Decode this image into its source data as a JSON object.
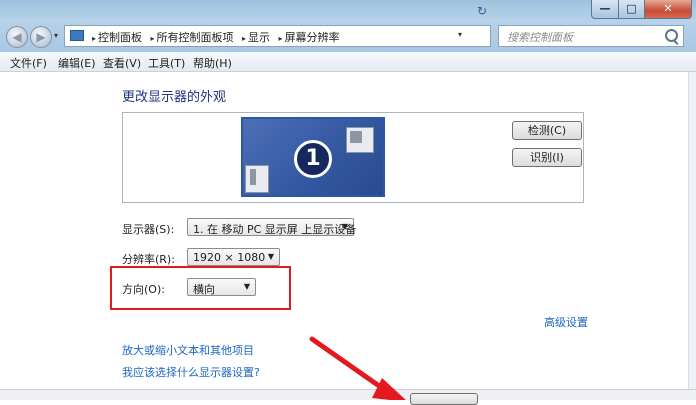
{
  "window": {
    "minimize_glyph": "—",
    "maximize_glyph": "□",
    "close_glyph": "✕"
  },
  "nav": {
    "back_glyph": "◀",
    "forward_glyph": "▶",
    "history_glyph": "▾"
  },
  "address": {
    "crumbs": [
      "控制面板",
      "所有控制面板项",
      "显示",
      "屏幕分辨率"
    ],
    "separator_glyph": "▸",
    "dropdown_glyph": "▾",
    "refresh_glyph": "↻"
  },
  "search": {
    "placeholder": "搜索控制面板"
  },
  "menu": [
    "文件(F)",
    "编辑(E)",
    "查看(V)",
    "工具(T)",
    "帮助(H)"
  ],
  "main": {
    "heading": "更改显示器的外观",
    "monitor_number": "1",
    "detect_button": "检测(C)",
    "identify_button": "识别(I)",
    "display_label": "显示器(S):",
    "display_value": "1. 在 移动 PC 显示屏 上显示设备",
    "resolution_label": "分辨率(R):",
    "resolution_value": "1920 × 1080",
    "orientation_label": "方向(O):",
    "orientation_value": "横向",
    "select_arrow": "▼",
    "advanced_link": "高级设置",
    "magnify_link": "放大或缩小文本和其他项目",
    "which_link": "我应该选择什么显示器设置?"
  },
  "colors": {
    "annotation": "#e3191f",
    "link": "#1c67c2",
    "heading": "#1e3287"
  }
}
